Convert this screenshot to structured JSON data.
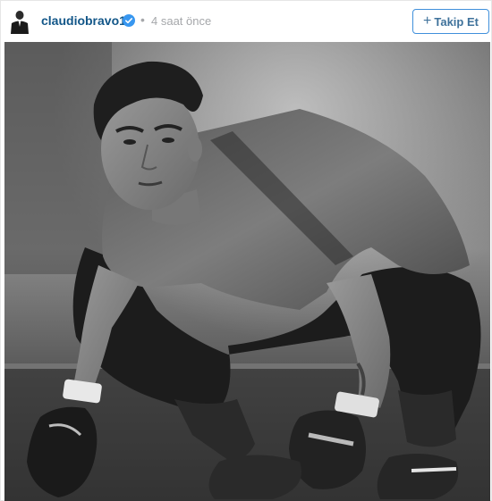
{
  "post": {
    "username": "claudiobravo1",
    "separator": "•",
    "timestamp": "4 saat önce",
    "follow_label": "Takip Et",
    "follow_plus": "+",
    "verified_icon": "verified-badge-icon",
    "verified_color": "#3897f0"
  },
  "colors": {
    "username": "#125688",
    "muted": "#a5a7aa",
    "follow_border": "#4090db"
  }
}
